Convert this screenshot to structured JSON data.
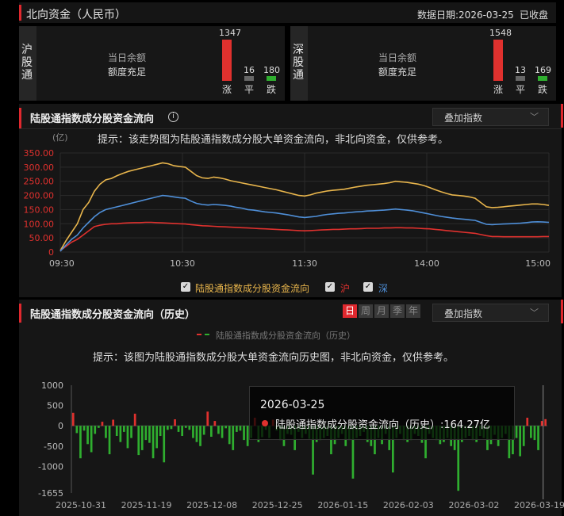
{
  "header": {
    "title": "北向资金（人民币）",
    "date_label": "数据日期:2026-03-25",
    "status": "已收盘"
  },
  "sh": {
    "name": "沪股通",
    "balance_label": "当日余额",
    "balance_value": "额度充足",
    "up": "1347",
    "flat": "16",
    "down": "180",
    "up_label": "涨",
    "flat_label": "平",
    "down_label": "跌"
  },
  "sz": {
    "name": "深股通",
    "balance_label": "当日余额",
    "balance_value": "额度充足",
    "up": "1548",
    "flat": "13",
    "down": "169",
    "up_label": "涨",
    "flat_label": "平",
    "down_label": "跌"
  },
  "intraday": {
    "title": "陆股通指数成分股资金流向",
    "info_icon": "info-circle-icon",
    "dropdown": "叠加指数",
    "unit": "(亿)",
    "hint": "提示：该走势图为陆股通指数成分股大单资金流向，非北向资金，仅供参考。",
    "legend": [
      {
        "label": "陆股通指数成分股资金流向",
        "color": "#e8b54c"
      },
      {
        "label": "沪",
        "color": "#e0312e"
      },
      {
        "label": "深",
        "color": "#4f8fd8"
      }
    ]
  },
  "history": {
    "title": "陆股通指数成分股资金流向（历史）",
    "tabs": [
      "日",
      "周",
      "月",
      "季",
      "年"
    ],
    "active_tab": "日",
    "dropdown": "叠加指数",
    "legend_label": "陆股通指数成分股资金流向（历史）",
    "hint": "提示：该图为陆股通指数成分股大单资金流向历史图，非北向资金，仅供参考。",
    "tooltip": {
      "date": "2026-03-25",
      "text": "陆股通指数成分股资金流向（历史）:164.27亿"
    }
  },
  "colors": {
    "total": "#e8b54c",
    "sh": "#e0312e",
    "sz": "#4f8fd8",
    "pos": "#e0312e",
    "neg": "#2fae2f",
    "accent": "#e0282e"
  },
  "chart_data": [
    {
      "type": "line",
      "x_ticks": [
        "09:30",
        "10:30",
        "11:30",
        "14:00",
        "15:00"
      ],
      "y_ticks": [
        "350.00",
        "300.00",
        "250.00",
        "200.00",
        "150.00",
        "100.00",
        "50.00",
        "0"
      ],
      "ylim": [
        0,
        350
      ],
      "ylabel": "(亿)",
      "grid": true,
      "series": [
        {
          "name": "陆股通指数成分股资金流向",
          "values": [
            5,
            40,
            70,
            100,
            150,
            175,
            215,
            240,
            255,
            260,
            270,
            278,
            285,
            290,
            295,
            300,
            305,
            310,
            315,
            312,
            305,
            302,
            300,
            285,
            270,
            262,
            260,
            265,
            262,
            258,
            252,
            248,
            244,
            240,
            236,
            232,
            228,
            224,
            220,
            215,
            210,
            205,
            200,
            198,
            202,
            208,
            212,
            216,
            218,
            220,
            222,
            226,
            230,
            233,
            236,
            238,
            240,
            242,
            245,
            250,
            248,
            246,
            243,
            240,
            235,
            228,
            220,
            213,
            207,
            202,
            200,
            198,
            195,
            190,
            175,
            160,
            157,
            158,
            160,
            162,
            164,
            166,
            168,
            170,
            170,
            168,
            165
          ]
        },
        {
          "name": "沪",
          "values": [
            5,
            20,
            35,
            45,
            60,
            75,
            90,
            95,
            98,
            100,
            100,
            102,
            103,
            104,
            104,
            105,
            105,
            104,
            103,
            102,
            101,
            100,
            99,
            97,
            95,
            93,
            92,
            91,
            90,
            89,
            88,
            87,
            86,
            85,
            84,
            83,
            82,
            81,
            80,
            79,
            78,
            77,
            76,
            75,
            76,
            77,
            78,
            79,
            80,
            80,
            81,
            82,
            82,
            83,
            84,
            84,
            84,
            85,
            85,
            86,
            86,
            85,
            85,
            84,
            83,
            82,
            80,
            78,
            76,
            74,
            72,
            70,
            68,
            66,
            62,
            58,
            55,
            55,
            54,
            54,
            54,
            54,
            54,
            54,
            54,
            55,
            55
          ]
        },
        {
          "name": "深",
          "values": [
            3,
            25,
            45,
            60,
            85,
            105,
            125,
            140,
            150,
            155,
            160,
            165,
            170,
            175,
            180,
            185,
            190,
            195,
            200,
            198,
            195,
            192,
            190,
            180,
            172,
            168,
            166,
            168,
            167,
            165,
            162,
            158,
            155,
            150,
            148,
            145,
            142,
            140,
            138,
            135,
            132,
            128,
            124,
            122,
            124,
            126,
            130,
            133,
            135,
            137,
            138,
            140,
            142,
            143,
            145,
            146,
            147,
            148,
            150,
            152,
            150,
            148,
            146,
            142,
            138,
            134,
            130,
            126,
            123,
            120,
            118,
            116,
            114,
            112,
            105,
            98,
            97,
            98,
            99,
            100,
            101,
            102,
            104,
            106,
            107,
            106,
            105
          ]
        }
      ]
    },
    {
      "type": "bar",
      "title": "陆股通指数成分股资金流向（历史）",
      "y_ticks": [
        "1000",
        "500",
        "0",
        "-500",
        "-1000",
        "-1655"
      ],
      "ylim": [
        -1655,
        1000
      ],
      "x_ticks": [
        "2025-10-31",
        "2025-11-19",
        "2025-12-08",
        "2025-12-25",
        "2026-01-15",
        "2026-02-03",
        "2026-03-02",
        "2026-03-19"
      ],
      "values": [
        320,
        -180,
        -800,
        -120,
        -450,
        -650,
        -200,
        -50,
        100,
        -300,
        -700,
        150,
        -250,
        -400,
        -150,
        -550,
        -300,
        300,
        -720,
        -600,
        -350,
        -420,
        -800,
        -550,
        -250,
        -900,
        -100,
        -80,
        160,
        -150,
        -250,
        -50,
        -100,
        -300,
        -400,
        -500,
        -220,
        350,
        -270,
        120,
        -200,
        -300,
        -60,
        -450,
        -600,
        -150,
        -120,
        -350,
        -500,
        -300,
        200,
        -400,
        -280,
        -100,
        -300,
        150,
        -120,
        -350,
        -500,
        -200,
        -220,
        -600,
        -150,
        -300,
        -200,
        -320,
        -1200,
        -400,
        -350,
        -300,
        -250,
        -700,
        -450,
        -300,
        -200,
        -500,
        -350,
        -1300,
        -300,
        -250,
        -150,
        -400,
        -500,
        -700,
        -300,
        -450,
        -200,
        -600,
        -1150,
        -300,
        -200,
        -350,
        -400,
        -350,
        -200,
        -250,
        -420,
        -800,
        -200,
        -300,
        -350,
        -450,
        -400,
        -300,
        -500,
        -600,
        -1600,
        -400,
        -300,
        -250,
        -350,
        -400,
        -250,
        -300,
        -600,
        -450,
        -220,
        -500,
        -300,
        -200,
        -800,
        -700,
        -300,
        -750,
        -500,
        200,
        -300,
        -350,
        -600,
        120,
        164.27
      ]
    }
  ]
}
